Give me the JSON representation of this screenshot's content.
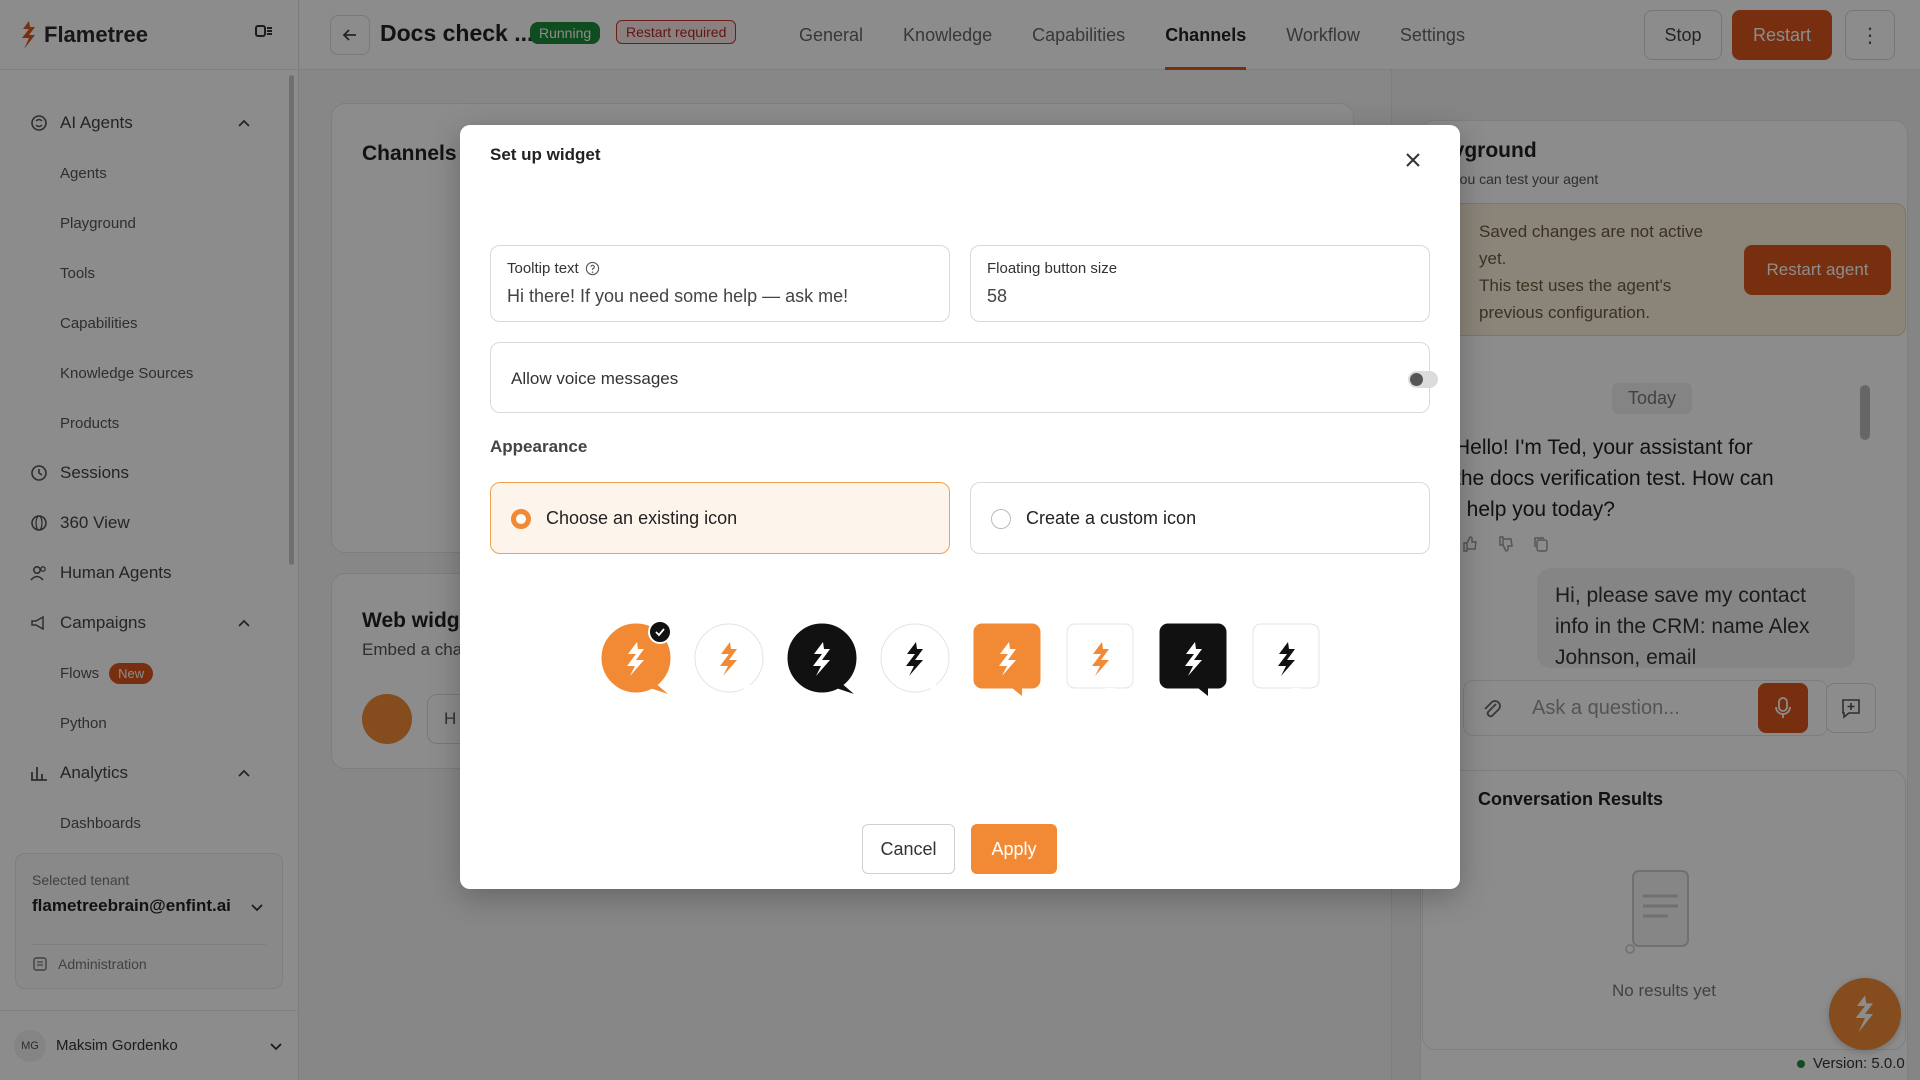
{
  "brand": {
    "name": "Flametree"
  },
  "sidebar": {
    "ai_agents": "AI Agents",
    "agents": "Agents",
    "playground": "Playground",
    "tools": "Tools",
    "capabilities": "Capabilities",
    "knowledge_sources": "Knowledge Sources",
    "products": "Products",
    "sessions": "Sessions",
    "view360": "360 View",
    "human_agents": "Human Agents",
    "campaigns": "Campaigns",
    "flows": "Flows",
    "flows_badge": "New",
    "python": "Python",
    "analytics": "Analytics",
    "dashboards": "Dashboards"
  },
  "tenant": {
    "label": "Selected tenant",
    "value": "flametreebrain@enfint.ai",
    "admin": "Administration"
  },
  "user": {
    "initials": "MG",
    "name": "Maksim Gordenko"
  },
  "header": {
    "title": "Docs check ...",
    "status_running": "Running",
    "status_restart": "Restart required",
    "tabs": [
      "General",
      "Knowledge",
      "Capabilities",
      "Channels",
      "Workflow",
      "Settings"
    ],
    "active_tab": "Channels",
    "stop": "Stop",
    "restart": "Restart",
    "more": "⋮"
  },
  "main": {
    "channels_title": "Channels",
    "web_widget_title": "Web widge",
    "web_widget_sub": "Embed a cha",
    "web_widget_preview": "H"
  },
  "playground": {
    "title": "ayground",
    "subtitle": "e you can test your agent",
    "warning_line1": "Saved changes are not active yet.",
    "warning_line2": "This test uses the agent's previous configuration.",
    "restart_agent": "Restart agent",
    "today": "Today",
    "bot_message": "Hello! I'm Ted, your assistant for the docs verification test. How can I help you today?",
    "user_message": "Hi, please save my contact info in the CRM: name Alex Johnson, email",
    "input_placeholder": "Ask a question...",
    "results_title": "Conversation Results",
    "results_empty": "No results yet",
    "version": "Version: 5.0.0"
  },
  "modal": {
    "title": "Set up widget",
    "tooltip_label": "Tooltip text",
    "tooltip_value": "Hi there! If you need some help — ask me!",
    "size_label": "Floating button size",
    "size_value": "58",
    "voice_label": "Allow voice messages",
    "voice_enabled": false,
    "appearance_label": "Appearance",
    "option_existing": "Choose an existing icon",
    "option_custom": "Create a custom icon",
    "selected_option": "existing",
    "icons": [
      {
        "shape": "circle",
        "bg": "#f28a35",
        "fg": "#ffffff",
        "selected": true
      },
      {
        "shape": "circle",
        "bg": "#ffffff",
        "fg": "#f28a35",
        "selected": false
      },
      {
        "shape": "circle",
        "bg": "#111111",
        "fg": "#ffffff",
        "selected": false
      },
      {
        "shape": "circle",
        "bg": "#ffffff",
        "fg": "#111111",
        "selected": false
      },
      {
        "shape": "square",
        "bg": "#f28a35",
        "fg": "#ffffff",
        "selected": false
      },
      {
        "shape": "square",
        "bg": "#ffffff",
        "fg": "#f28a35",
        "selected": false
      },
      {
        "shape": "square",
        "bg": "#111111",
        "fg": "#ffffff",
        "selected": false
      },
      {
        "shape": "square",
        "bg": "#ffffff",
        "fg": "#111111",
        "selected": false
      }
    ],
    "cancel": "Cancel",
    "apply": "Apply"
  },
  "colors": {
    "accent": "#d9571d",
    "accent_light": "#f28a35",
    "running": "#1d8a3a"
  }
}
